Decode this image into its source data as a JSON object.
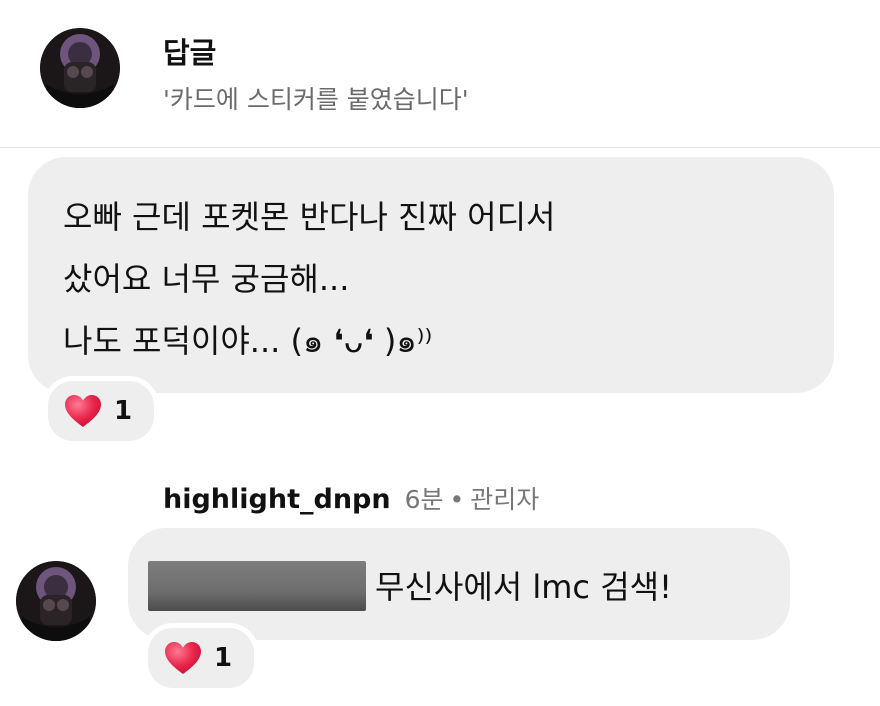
{
  "header": {
    "title": "답글",
    "subtitle": "'카드에 스티커를 붙였습니다'"
  },
  "comment": {
    "lines": [
      "오빠 근데 포켓몬 반다나 진짜 어디서",
      "샀어요 너무 궁금해...",
      "나도 포덕이야... (๑ ❛ᴗ❛ )๑⁾⁾"
    ],
    "reaction_count": "1"
  },
  "reply": {
    "username": "highlight_dnpn",
    "time": "6분",
    "separator": "•",
    "role": "관리자",
    "text": "무신사에서 lmc 검색!",
    "reaction_count": "1"
  },
  "icons": {
    "reaction": "heart-icon",
    "avatar": "avatar"
  },
  "colors": {
    "bubble": "#eeeeee",
    "heart": "#e8264a",
    "muted": "#6b6b6b"
  }
}
